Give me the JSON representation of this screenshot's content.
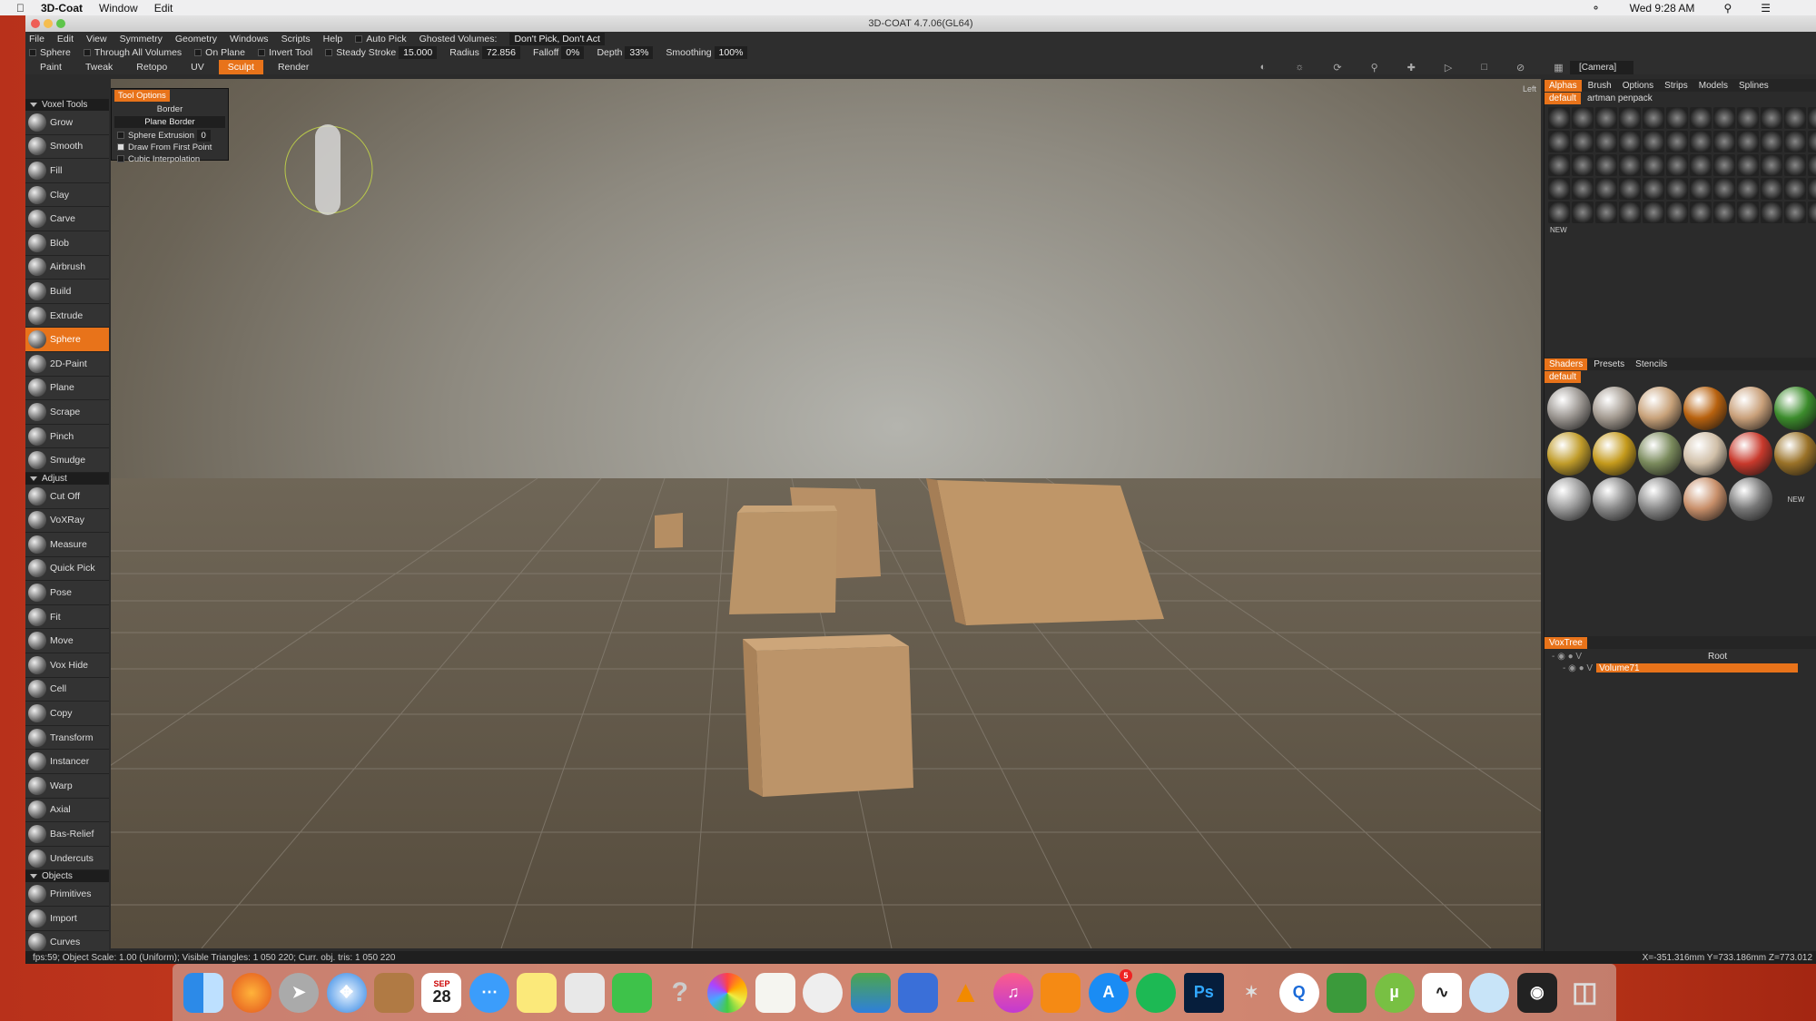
{
  "menubar": {
    "app": "3D-Coat",
    "items": [
      "Window",
      "Edit"
    ],
    "clock": "Wed 9:28 AM"
  },
  "window": {
    "title": "3D-COAT 4.7.06(GL64)"
  },
  "appmenu": {
    "items": [
      "File",
      "Edit",
      "View",
      "Symmetry",
      "Geometry",
      "Windows",
      "Scripts",
      "Help"
    ],
    "auto_pick": "Auto Pick",
    "ghosted_label": "Ghosted Volumes:",
    "ghosted_value": "Don't Pick, Don't Act"
  },
  "toolbar": {
    "tool": "Sphere",
    "through": "Through All Volumes",
    "on_plane": "On Plane",
    "invert": "Invert Tool",
    "steady": "Steady Stroke",
    "steady_val": "15.000",
    "radius": "Radius",
    "radius_val": "72.856",
    "falloff": "Falloff",
    "falloff_val": "0%",
    "depth": "Depth",
    "depth_val": "33%",
    "smoothing": "Smoothing",
    "smoothing_val": "100%"
  },
  "rooms": [
    "Paint",
    "Tweak",
    "Retopo",
    "UV",
    "Sculpt",
    "Render"
  ],
  "camera": "[Camera]",
  "view_label": "Left",
  "tool_options": {
    "tab": "Tool Options",
    "border": "Border",
    "dropdown": "Plane Border",
    "extrusion_label": "Sphere Extrusion",
    "extrusion_val": "0",
    "opt1": "Draw From First Point",
    "opt2": "Cubic Interpolation"
  },
  "left_panel": {
    "sections": [
      {
        "title": "Voxel Tools",
        "tools": [
          "Grow",
          "Smooth",
          "Fill",
          "Clay",
          "Carve",
          "Blob",
          "Airbrush",
          "Build",
          "Extrude",
          "Sphere",
          "2D-Paint",
          "Plane",
          "Scrape",
          "Pinch",
          "Smudge"
        ]
      },
      {
        "title": "Adjust",
        "tools": [
          "Cut Off",
          "VoXRay",
          "Measure",
          "Quick Pick",
          "Pose",
          "Fit",
          "Move",
          "Vox Hide",
          "Cell",
          "Copy",
          "Transform",
          "Instancer",
          "Warp",
          "Axial",
          "Bas-Relief",
          "Undercuts"
        ]
      },
      {
        "title": "Objects",
        "tools": [
          "Primitives",
          "Import",
          "Curves"
        ]
      }
    ],
    "selected": "Sphere"
  },
  "alphas_panel": {
    "tabs": [
      "Alphas",
      "Brush",
      "Options",
      "Strips",
      "Models",
      "Splines"
    ],
    "presets": [
      "default",
      "artman penpack"
    ],
    "new": "NEW"
  },
  "shaders_panel": {
    "tabs": [
      "Shaders",
      "Presets",
      "Stencils"
    ],
    "preset": "default",
    "new": "NEW",
    "colors": [
      "#9a9590",
      "#a39a90",
      "#c8a27a",
      "#b8620f",
      "#c9a07a",
      "#3c8c2c",
      "#c09c2a",
      "#c49a1c",
      "#7a8a5c",
      "#d0bfa8",
      "#c8392c",
      "#9a7228",
      "#9a9a9a",
      "#888888",
      "#8a8a8a",
      "#c88f6a",
      "#777777"
    ]
  },
  "voxtree": {
    "tab": "VoxTree",
    "root": "Root",
    "volume": "Volume71"
  },
  "status": {
    "left": "fps:59;    Object Scale: 1.00 (Uniform); Visible Triangles: 1 050 220; Curr. obj. tris: 1 050 220",
    "right": "X=-351.316mm  Y=733.186mm  Z=773.012"
  },
  "dock": {
    "calendar_month": "SEP",
    "calendar_day": "28",
    "appstore_badge": "5"
  }
}
